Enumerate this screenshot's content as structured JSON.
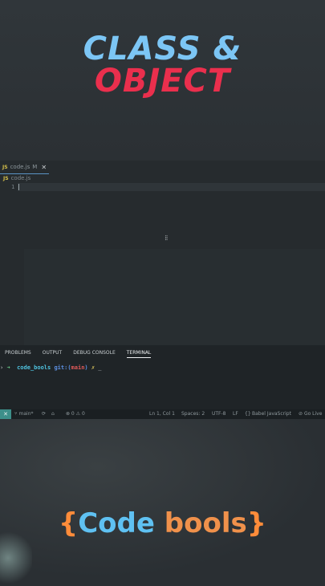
{
  "title": {
    "line1": "CLASS &",
    "line2": "OBJECT"
  },
  "editor": {
    "tab": {
      "badge": "JS",
      "filename": "code.js",
      "status": "M",
      "close": "✕"
    },
    "breadcrumb": {
      "badge": "JS",
      "filename": "code.js"
    },
    "line_number": "1",
    "center_mark": "⣿"
  },
  "panel": {
    "tabs": [
      "PROBLEMS",
      "OUTPUT",
      "DEBUG CONSOLE",
      "TERMINAL"
    ],
    "active_tab": "TERMINAL",
    "terminal": {
      "arrow": "➜",
      "dir": "code_bools",
      "git": "git:(",
      "branch": "main",
      "git_close": ")",
      "mark": "✗",
      "cursor": "_"
    }
  },
  "status_bar": {
    "remote_icon": "✕",
    "branch": "main*",
    "sync_icon": "⟳",
    "errors": "⊗ 0 ⚠ 0",
    "position": "Ln 1, Col 1",
    "spaces": "Spaces: 2",
    "encoding": "UTF-8",
    "eol": "LF",
    "braces": "{}",
    "language": "Babel JavaScript",
    "golive": "Go Live"
  },
  "brand": {
    "open": "{",
    "code": "Code",
    "bools": "bools",
    "close": "}"
  }
}
